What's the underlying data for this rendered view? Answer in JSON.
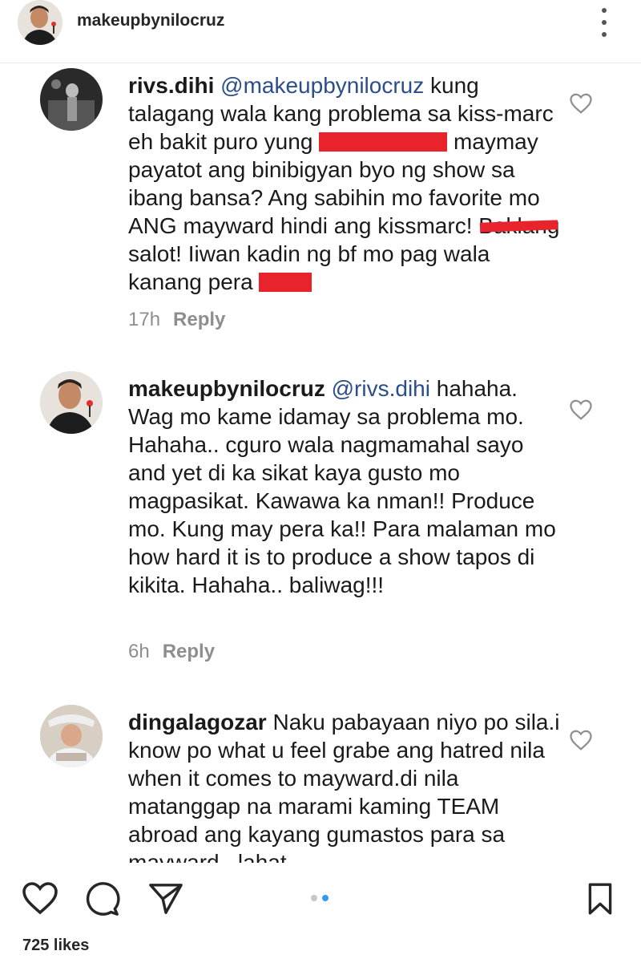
{
  "header": {
    "username": "makeupbynilocruz"
  },
  "comments": [
    {
      "username": "rivs.dihi",
      "mention": "@makeupbynilocruz",
      "text_part1": "kung talagang wala kang problema sa kiss-marc eh bakit puro yung",
      "text_part2": "maymay payatot ang binibigyan byo ng show sa ibang bansa? Ang sabihin mo favorite mo ANG mayward hindi ang kissmarc!",
      "strike_word": "Baklang",
      "text_part3": "salot! Iiwan kadin ng bf mo pag wala kanang pera",
      "time": "17h",
      "reply_label": "Reply"
    },
    {
      "username": "makeupbynilocruz",
      "mention": "@rivs.dihi",
      "text": "hahaha. Wag mo kame idamay sa problema mo. Hahaha.. cguro wala nagmamahal sayo and yet di ka sikat kaya gusto mo magpasikat. Kawawa ka nman!! Produce mo. Kung may pera ka!! Para malaman mo how hard it is to produce a show tapos di kikita. Hahaha.. baliwag!!!",
      "time": "6h",
      "reply_label": "Reply"
    },
    {
      "username": "dingalagozar",
      "text": "Naku pabayaan niyo po sila.i know po what u feel grabe ang hatred nila when it comes to mayward.di nila matanggap na marami kaming TEAM abroad ang kayang gumastos para sa mayward...lahat"
    }
  ],
  "footer": {
    "likes": "725 likes",
    "carousel_total": 2,
    "carousel_active": 2
  },
  "colors": {
    "redaction": "#e8232c",
    "mention": "#2b4d8a",
    "carousel_active": "#3897f0"
  },
  "icons": [
    "kebab-menu-icon",
    "heart-icon",
    "comment-icon",
    "share-icon",
    "bookmark-icon"
  ]
}
